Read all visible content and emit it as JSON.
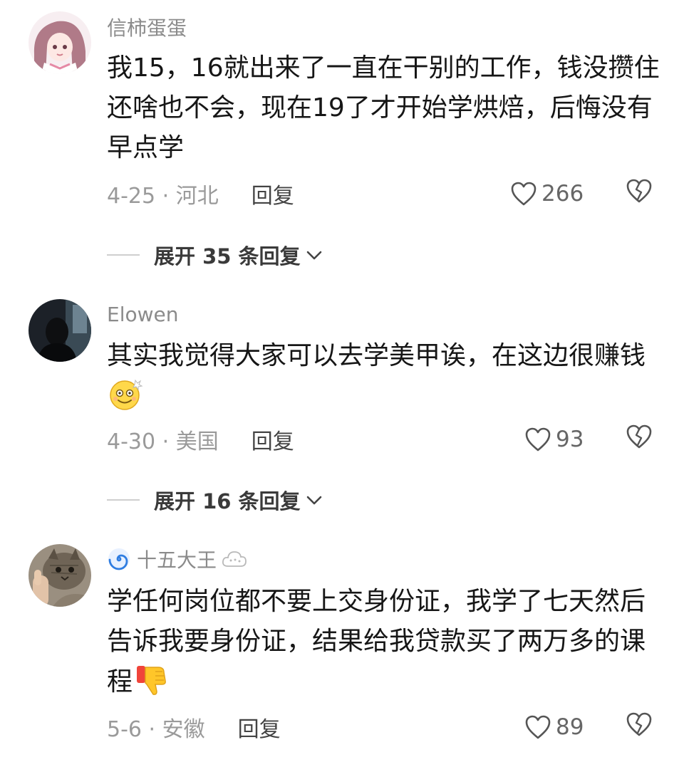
{
  "comments": [
    {
      "username": "信柿蛋蛋",
      "text_lines": [
        "我15，16就出来了一直在干别的工作，钱没攒住",
        "还啥也不会，现在19了才开始学烘焙，后悔没有",
        "早点学"
      ],
      "date_location": "4-25 · 河北",
      "reply_label": "回复",
      "likes": "266",
      "expand_label": "展开 35 条回复",
      "avatar_icon": "anime-girl-avatar"
    },
    {
      "username": "Elowen",
      "text_lines": [
        "其实我觉得大家可以去学美甲诶，在这边很赚钱"
      ],
      "emoji": "dazed-smile-emoji",
      "date_location": "4-30 · 美国",
      "reply_label": "回复",
      "likes": "93",
      "expand_label": "展开 16 条回复",
      "avatar_icon": "dark-portrait-avatar"
    },
    {
      "username": "十五大王",
      "username_icon": "swirl-icon",
      "username_badge": "cloud-badge-icon",
      "text_lines": [
        "学任何岗位都不要上交身份证，我学了七天然后",
        "告诉我要身份证，结果给我贷款买了两万多的课",
        "程"
      ],
      "emoji": "thumbs-down-emoji",
      "date_location": "5-6 · 安徽",
      "reply_label": "回复",
      "likes": "89",
      "avatar_icon": "cat-photo-avatar"
    }
  ],
  "colors": {
    "username": "#8b8b8b",
    "text": "#161616",
    "meta": "#9a9a9a",
    "reply": "#444444",
    "swirl": "#2f7de1"
  }
}
